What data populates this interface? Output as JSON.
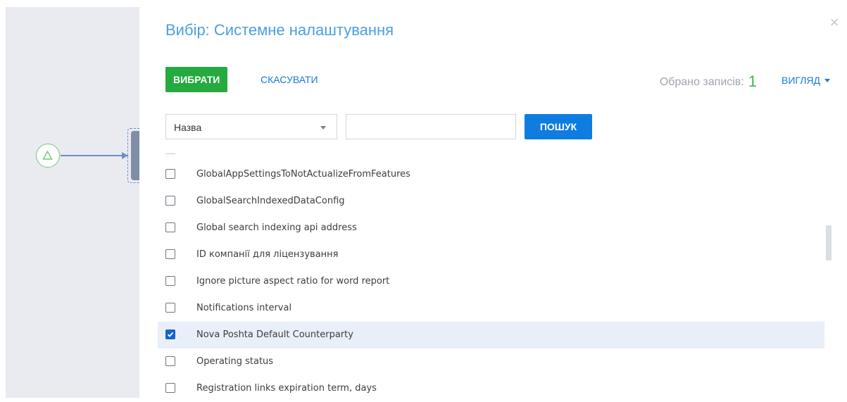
{
  "modal": {
    "title": "Вибір: Системне налаштування",
    "select_label": "ВИБРАТИ",
    "cancel_label": "СКАСУВАТИ",
    "selected_count_label": "Обрано записів:",
    "selected_count": "1",
    "view_label": "ВИГЛЯД",
    "close_icon": "close-icon",
    "accent_color": "#24aa3e",
    "link_color": "#1a7ad6"
  },
  "search": {
    "field_value": "Назва",
    "input_value": "",
    "search_label": "ПОШУК"
  },
  "list": {
    "items": [
      {
        "label": "GlobalAppSettingsToNotActualizeFromFeatures",
        "checked": false
      },
      {
        "label": "GlobalSearchIndexedDataConfig",
        "checked": false
      },
      {
        "label": "Global search indexing api address",
        "checked": false
      },
      {
        "label": "ID компанії для ліцензування",
        "checked": false
      },
      {
        "label": "Ignore picture aspect ratio for word report",
        "checked": false
      },
      {
        "label": "Notifications interval",
        "checked": false
      },
      {
        "label": "Nova Poshta Default Counterparty",
        "checked": true
      },
      {
        "label": "Operating status",
        "checked": false
      },
      {
        "label": "Registration links expiration term, days",
        "checked": false
      }
    ]
  }
}
